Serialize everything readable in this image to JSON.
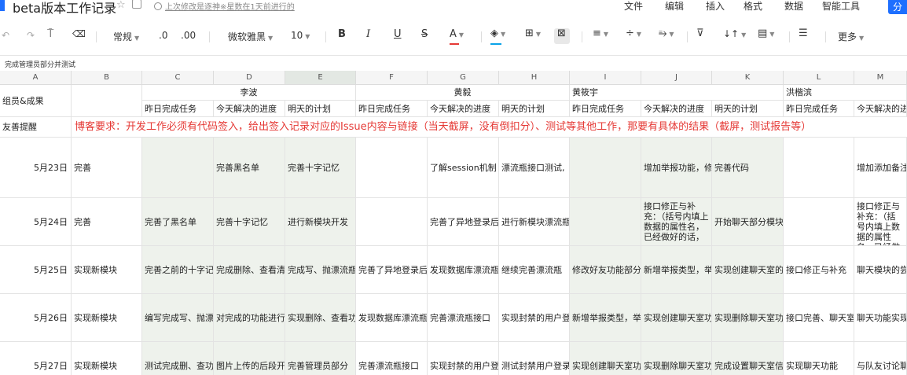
{
  "title_bar": {
    "doc_title": "beta版本工作记录",
    "last_edit": "上次修改是逐神※星数在1天前进行的",
    "menus": [
      "文件",
      "编辑",
      "插入",
      "格式",
      "数据",
      "智能工具"
    ],
    "corner_button": "分"
  },
  "toolbar": {
    "number_format": "常规",
    "decrease_decimal": ".0",
    "increase_decimal": ".00",
    "font_family": "微软雅黑",
    "font_size": "10",
    "bold": "B",
    "italic": "I",
    "underline": "U",
    "strike": "S",
    "font_color": "A",
    "more": "更多",
    "accent_color": "#1e6fff",
    "font_color_bar": "#e53935",
    "fill_color_bar": "#0aa3e8"
  },
  "formula_bar": {
    "content": "完成管理员部分并测试"
  },
  "grid": {
    "columns": [
      "A",
      "B",
      "C",
      "D",
      "E",
      "F",
      "G",
      "H",
      "I",
      "J",
      "K",
      "L",
      "M"
    ],
    "row1": {
      "label": "组员&成果",
      "person1": "李波",
      "person2": "黄毅",
      "person3": "黄筱宇",
      "person4": "洪楷滨"
    },
    "subheaders": {
      "c": "昨日完成任务",
      "d": "今天解决的进度",
      "e": "明天的计划",
      "f": "昨日完成任务",
      "g": "今天解决的进度",
      "h": "明天的计划",
      "i": "昨日完成任务",
      "j": "今天解决的进度",
      "k": "明天的计划",
      "l": "昨日完成任务",
      "m": "今天解决的进"
    },
    "reminder_label": "友善提醒",
    "reminder": "博客要求：开发工作必须有代码签入，给出签入记录对应的Issue内容与链接（当天截屏，没有倒扣分）、测试等其他工作，那要有具体的结果（截屏，测试报告等）",
    "rows": [
      {
        "date": "5月23日",
        "b": "完善",
        "c": "",
        "d": "完善黑名单",
        "e": "完善十字记忆",
        "f": "",
        "g": "了解session机制",
        "h": "漂流瓶接口测试,",
        "i": "",
        "j": "增加举报功能，修",
        "k": "完善代码",
        "l": "",
        "m": "增加添加备注"
      },
      {
        "date": "5月24日",
        "b": "完善",
        "c": "完善了黑名单",
        "d": "完善十字记忆",
        "e": "进行新模块开发",
        "f": "",
        "g": "完善了异地登录后",
        "h": "进行新模块漂流瓶",
        "i": "",
        "j": "接口修正与补充：（括号内填上数据的属性名，已经做好的话，",
        "k": "开始聊天部分模块",
        "l": "",
        "m": "接口修正与补充：（括号内填上数据的属性名，已经做好的话"
      },
      {
        "date": "5月25日",
        "b": "实现新模块",
        "c": "完善之前的十字记",
        "d": "完成删除、查看清",
        "e": "完成写、抛漂流瓶",
        "f": "完善了异地登录后",
        "g": "发现数据库漂流瓶",
        "h": "继续完善漂流瓶",
        "i": "修改好友功能部分",
        "j": "新增举报类型，举",
        "k": "实现创建聊天室的",
        "l": "接口修正与补充",
        "m": "聊天模块的尝"
      },
      {
        "date": "5月26日",
        "b": "实现新模块",
        "c": "编写完成写、抛漂",
        "d": "对完成的功能进行",
        "e": "实现删除、查看功",
        "f": "发现数据库漂流瓶",
        "g": "完善漂流瓶接口",
        "h": "实现封禁的用户登",
        "i": "新增举报类型，举",
        "j": "实现创建聊天室功",
        "k": "实现删除聊天室功",
        "l": "接口完善、聊天室",
        "m": "聊天功能实现"
      },
      {
        "date": "5月27日",
        "b": "实现新模块",
        "c": "测试完成删、查功",
        "d": "图片上传的后段开",
        "e": "完善管理员部分",
        "f": "完善漂流瓶接口",
        "g": "实现封禁的用户登",
        "h": "测试封禁用户登录",
        "i": "实现创建聊天室功",
        "j": "实现删除聊天室功",
        "k": "完成设置聊天室信",
        "l": "实现聊天功能",
        "m": "与队友讨论聊"
      }
    ]
  }
}
